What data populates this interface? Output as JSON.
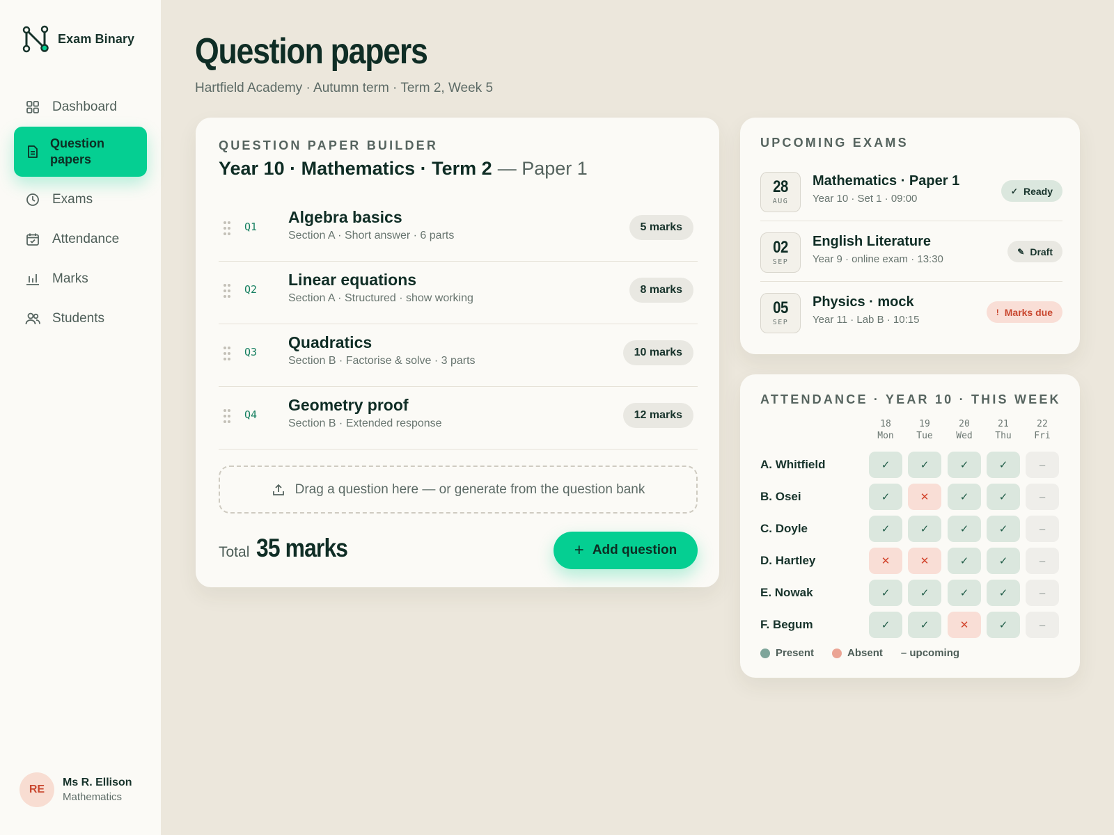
{
  "brand": {
    "name": "Exam Binary"
  },
  "nav": [
    {
      "label": "Dashboard",
      "icon": "grid-icon",
      "active": false
    },
    {
      "label": "Question papers",
      "icon": "document-icon",
      "active": true
    },
    {
      "label": "Exams",
      "icon": "clock-icon",
      "active": false
    },
    {
      "label": "Attendance",
      "icon": "calendar-check-icon",
      "active": false
    },
    {
      "label": "Marks",
      "icon": "bar-chart-icon",
      "active": false
    },
    {
      "label": "Students",
      "icon": "users-icon",
      "active": false
    }
  ],
  "user": {
    "initials": "RE",
    "name": "Ms R. Ellison",
    "role": "Mathematics"
  },
  "header": {
    "title": "Question papers",
    "subtitle": "Hartfield Academy · Autumn term · Term 2, Week 5"
  },
  "builder": {
    "kicker": "QUESTION PAPER BUILDER",
    "title": "Year 10 · Mathematics · Term 2",
    "paper": "— Paper 1",
    "questions": [
      {
        "num": "Q1",
        "title": "Algebra basics",
        "meta": "Section A · Short answer · 6 parts",
        "marks": "5 marks"
      },
      {
        "num": "Q2",
        "title": "Linear equations",
        "meta": "Section A · Structured · show working",
        "marks": "8 marks"
      },
      {
        "num": "Q3",
        "title": "Quadratics",
        "meta": "Section B · Factorise & solve · 3 parts",
        "marks": "10 marks"
      },
      {
        "num": "Q4",
        "title": "Geometry proof",
        "meta": "Section B · Extended response",
        "marks": "12 marks"
      }
    ],
    "dropzone": "Drag a question here — or generate from the question bank",
    "total_label": "Total",
    "total_value": "35 marks",
    "add_label": "Add question"
  },
  "upcoming": {
    "kicker": "UPCOMING EXAMS",
    "exams": [
      {
        "day": "28",
        "month": "AUG",
        "title": "Mathematics · Paper 1",
        "meta": "Year 10 · Set 1 · 09:00",
        "status": "Ready",
        "status_type": "ready",
        "status_icon": "check-icon"
      },
      {
        "day": "02",
        "month": "SEP",
        "title": "English Literature",
        "meta": "Year 9 · online exam · 13:30",
        "status": "Draft",
        "status_type": "draft",
        "status_icon": "pencil-icon"
      },
      {
        "day": "05",
        "month": "SEP",
        "title": "Physics · mock",
        "meta": "Year 11 · Lab B · 10:15",
        "status": "Marks due",
        "status_type": "due",
        "status_icon": "alert-icon"
      }
    ]
  },
  "attendance": {
    "kicker": "ATTENDANCE · YEAR 10 · THIS WEEK",
    "days": [
      {
        "date": "18",
        "dow": "Mon"
      },
      {
        "date": "19",
        "dow": "Tue"
      },
      {
        "date": "20",
        "dow": "Wed"
      },
      {
        "date": "21",
        "dow": "Thu"
      },
      {
        "date": "22",
        "dow": "Fri"
      }
    ],
    "students": [
      {
        "name": "A. Whitfield",
        "marks": [
          "present",
          "present",
          "present",
          "present",
          "upcoming"
        ]
      },
      {
        "name": "B. Osei",
        "marks": [
          "present",
          "absent",
          "present",
          "present",
          "upcoming"
        ]
      },
      {
        "name": "C. Doyle",
        "marks": [
          "present",
          "present",
          "present",
          "present",
          "upcoming"
        ]
      },
      {
        "name": "D. Hartley",
        "marks": [
          "absent",
          "absent",
          "present",
          "present",
          "upcoming"
        ]
      },
      {
        "name": "E. Nowak",
        "marks": [
          "present",
          "present",
          "present",
          "present",
          "upcoming"
        ]
      },
      {
        "name": "F. Begum",
        "marks": [
          "present",
          "present",
          "absent",
          "present",
          "upcoming"
        ]
      }
    ],
    "legend": {
      "present": "Present",
      "absent": "Absent",
      "upcoming": "– upcoming"
    }
  },
  "colors": {
    "accent": "#05cf92",
    "present": "#7ea59a",
    "absent": "#eba494",
    "background": "#ece7dc"
  }
}
